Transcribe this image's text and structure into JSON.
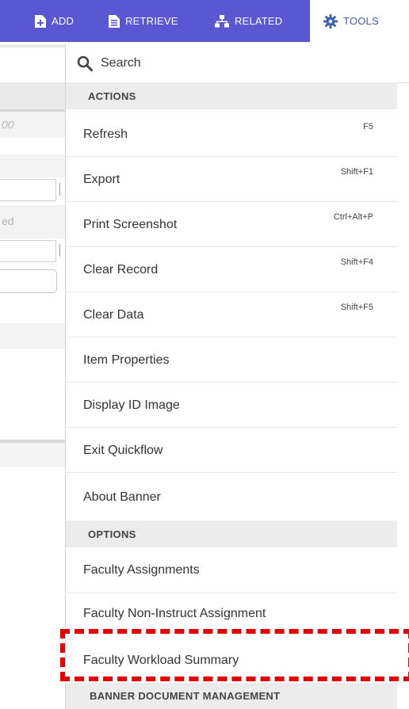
{
  "toolbar": {
    "add_label": "ADD",
    "retrieve_label": "RETRIEVE",
    "related_label": "RELATED",
    "tools_label": "TOOLS"
  },
  "background_form": {
    "field_hint_1": "00",
    "field_hint_2": "ed"
  },
  "menu": {
    "search_placeholder": "Search",
    "actions_header": "ACTIONS",
    "actions": [
      {
        "label": "Refresh",
        "shortcut": "F5"
      },
      {
        "label": "Export",
        "shortcut": "Shift+F1"
      },
      {
        "label": "Print Screenshot",
        "shortcut": "Ctrl+Alt+P"
      },
      {
        "label": "Clear Record",
        "shortcut": "Shift+F4"
      },
      {
        "label": "Clear Data",
        "shortcut": "Shift+F5"
      },
      {
        "label": "Item Properties",
        "shortcut": ""
      },
      {
        "label": "Display ID Image",
        "shortcut": ""
      },
      {
        "label": "Exit Quickflow",
        "shortcut": ""
      },
      {
        "label": "About Banner",
        "shortcut": ""
      }
    ],
    "options_header": "OPTIONS",
    "options": [
      {
        "label": "Faculty Assignments"
      },
      {
        "label": "Faculty Non-Instruct Assignment"
      },
      {
        "label": "Faculty Workload Summary"
      }
    ],
    "bdm_header": "BANNER DOCUMENT MANAGEMENT"
  },
  "colors": {
    "toolbar": "#5a57d3",
    "tools_text": "#3b63a8",
    "section_bg": "#ececec",
    "annotation": "#e20000"
  }
}
